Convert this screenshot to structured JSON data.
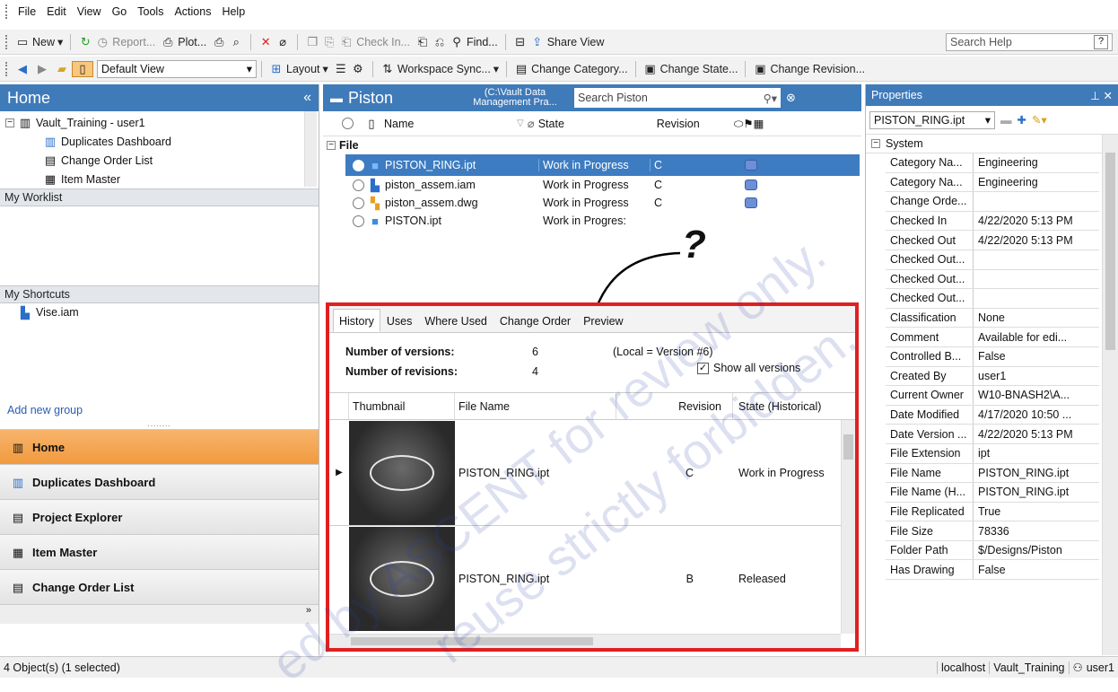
{
  "menubar": [
    "File",
    "Edit",
    "View",
    "Go",
    "Tools",
    "Actions",
    "Help"
  ],
  "toolbar1": {
    "new": "New",
    "report": "Report...",
    "plot": "Plot...",
    "check_in": "Check In...",
    "find": "Find...",
    "share_view": "Share View",
    "search_help": "Search Help"
  },
  "toolbar2": {
    "view_select": "Default View",
    "layout": "Layout",
    "workspace_sync": "Workspace Sync...",
    "change_category": "Change Category...",
    "change_state": "Change State...",
    "change_revision": "Change Revision..."
  },
  "left": {
    "title": "Home",
    "tree": [
      {
        "label": "Vault_Training - user1"
      },
      {
        "label": "Duplicates Dashboard"
      },
      {
        "label": "Change Order List"
      },
      {
        "label": "Item Master"
      }
    ],
    "worklist": "My Worklist",
    "shortcuts": "My Shortcuts",
    "shortcut_items": [
      "Vise.iam"
    ],
    "add_group": "Add new group",
    "nav": [
      "Home",
      "Duplicates Dashboard",
      "Project Explorer",
      "Item Master",
      "Change Order List"
    ]
  },
  "center": {
    "folder": "Piston",
    "path_line1": "(C:\\Vault Data",
    "path_line2": "Management Pra...",
    "search_placeholder": "Search Piston",
    "columns": {
      "name": "Name",
      "state": "State",
      "revision": "Revision"
    },
    "group": "File",
    "files": [
      {
        "name": "PISTON_RING.ipt",
        "state": "Work in Progress",
        "rev": "C"
      },
      {
        "name": "piston_assem.iam",
        "state": "Work in Progress",
        "rev": "C"
      },
      {
        "name": "piston_assem.dwg",
        "state": "Work in Progress",
        "rev": "C"
      },
      {
        "name": "PISTON.ipt",
        "state": "Work in Progres:",
        "rev": ""
      }
    ],
    "question": "?"
  },
  "history": {
    "tabs": [
      "History",
      "Uses",
      "Where Used",
      "Change Order",
      "Preview"
    ],
    "num_versions_label": "Number of versions:",
    "num_versions": "6",
    "local": "(Local = Version #6)",
    "num_revisions_label": "Number of revisions:",
    "num_revisions": "4",
    "show_all": "Show all versions",
    "cols": [
      "Thumbnail",
      "File Name",
      "Revision",
      "State (Historical)"
    ],
    "rows": [
      {
        "file": "PISTON_RING.ipt",
        "rev": "C",
        "state": "Work in Progress"
      },
      {
        "file": "PISTON_RING.ipt",
        "rev": "B",
        "state": "Released"
      }
    ]
  },
  "properties": {
    "title": "Properties",
    "file": "PISTON_RING.ipt",
    "group": "System",
    "rows": [
      [
        "Category Na...",
        "Engineering"
      ],
      [
        "Category Na...",
        "Engineering"
      ],
      [
        "Change Orde...",
        ""
      ],
      [
        "Checked In",
        "4/22/2020 5:13 PM"
      ],
      [
        "Checked Out",
        "4/22/2020 5:13 PM"
      ],
      [
        "Checked Out...",
        ""
      ],
      [
        "Checked Out...",
        ""
      ],
      [
        "Checked Out...",
        ""
      ],
      [
        "Classification",
        "None"
      ],
      [
        "Comment",
        "Available for edi..."
      ],
      [
        "Controlled B...",
        "False"
      ],
      [
        "Created By",
        "user1"
      ],
      [
        "Current Owner",
        "W10-BNASH2\\A..."
      ],
      [
        "Date Modified",
        "4/17/2020 10:50 ..."
      ],
      [
        "Date Version ...",
        "4/22/2020 5:13 PM"
      ],
      [
        "File Extension",
        "ipt"
      ],
      [
        "File Name",
        "PISTON_RING.ipt"
      ],
      [
        "File Name (H...",
        "PISTON_RING.ipt"
      ],
      [
        "File Replicated",
        "True"
      ],
      [
        "File Size",
        "78336"
      ],
      [
        "Folder Path",
        "$/Designs/Piston"
      ],
      [
        "Has Drawing",
        "False"
      ]
    ]
  },
  "status": {
    "left": "4 Object(s) (1 selected)",
    "server": "localhost",
    "vault": "Vault_Training",
    "user": "user1"
  },
  "watermark": [
    "ed by ASCENT for review only.",
    "reuse strictly forbidden."
  ]
}
